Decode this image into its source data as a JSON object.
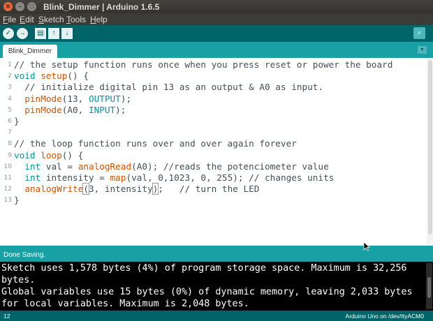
{
  "window": {
    "title": "Blink_Dimmer | Arduino 1.6.5"
  },
  "menu": [
    {
      "u": "F",
      "rest": "ile"
    },
    {
      "u": "E",
      "rest": "dit"
    },
    {
      "u": "S",
      "rest": "ketch"
    },
    {
      "u": "T",
      "rest": "ools"
    },
    {
      "u": "H",
      "rest": "elp"
    }
  ],
  "toolbar": {
    "verify_icon": "✓",
    "upload_icon": "→",
    "new_icon": "▤",
    "open_icon": "↑",
    "save_icon": "↓",
    "serial_icon": "⌕"
  },
  "tabs": [
    {
      "label": "Blink_Dimmer"
    }
  ],
  "code_lines": [
    [
      {
        "t": "// the setup function runs once when you press reset or power the board",
        "c": "cm"
      }
    ],
    [
      {
        "t": "void ",
        "c": "kw"
      },
      {
        "t": "setup",
        "c": "fn"
      },
      {
        "t": "() {",
        "c": ""
      }
    ],
    [
      {
        "t": "  // initialize digital pin 13 as an output & A0 as input.",
        "c": "cm"
      }
    ],
    [
      {
        "t": "  ",
        "c": ""
      },
      {
        "t": "pinMode",
        "c": "fn"
      },
      {
        "t": "(13, ",
        "c": ""
      },
      {
        "t": "OUTPUT",
        "c": "kw"
      },
      {
        "t": ");",
        "c": ""
      }
    ],
    [
      {
        "t": "  ",
        "c": ""
      },
      {
        "t": "pinMode",
        "c": "fn"
      },
      {
        "t": "(A0, ",
        "c": ""
      },
      {
        "t": "INPUT",
        "c": "kw"
      },
      {
        "t": ");",
        "c": ""
      }
    ],
    [
      {
        "t": "}",
        "c": ""
      }
    ],
    [],
    [
      {
        "t": "// the loop function runs over and over again forever",
        "c": "cm"
      }
    ],
    [
      {
        "t": "void ",
        "c": "kw"
      },
      {
        "t": "loop",
        "c": "fn"
      },
      {
        "t": "() {",
        "c": ""
      }
    ],
    [
      {
        "t": "  ",
        "c": ""
      },
      {
        "t": "int",
        "c": "kw"
      },
      {
        "t": " val = ",
        "c": ""
      },
      {
        "t": "analogRead",
        "c": "fn"
      },
      {
        "t": "(A0); //reads the potenciometer value",
        "c": ""
      }
    ],
    [
      {
        "t": "  ",
        "c": ""
      },
      {
        "t": "int",
        "c": "kw"
      },
      {
        "t": " intensity = ",
        "c": ""
      },
      {
        "t": "map",
        "c": "fn"
      },
      {
        "t": "(val, 0,1023, 0, 255); // changes units",
        "c": ""
      }
    ],
    [
      {
        "t": "  ",
        "c": ""
      },
      {
        "t": "analogWrite",
        "c": "fn"
      },
      {
        "t": "(",
        "c": "br"
      },
      {
        "t": "3, intensity",
        "c": ""
      },
      {
        "t": ")",
        "c": "br"
      },
      {
        "t": ";   // turn the LED",
        "c": ""
      }
    ],
    [
      {
        "t": "}",
        "c": ""
      }
    ]
  ],
  "status": {
    "text": "Done Saving."
  },
  "console": {
    "lines": [
      "Sketch uses 1,578 bytes (4%) of program storage space. Maximum is 32,256",
      "bytes.",
      "Global variables use 15 bytes (0%) of dynamic memory, leaving 2,033 bytes",
      "for local variables. Maximum is 2,048 bytes."
    ]
  },
  "bottom": {
    "line_number": "12",
    "board": "Arduino Uno on /dev/ttyACM0"
  },
  "colors": {
    "teal": "#00979c",
    "dark_teal": "#006468",
    "orange": "#d35400"
  }
}
